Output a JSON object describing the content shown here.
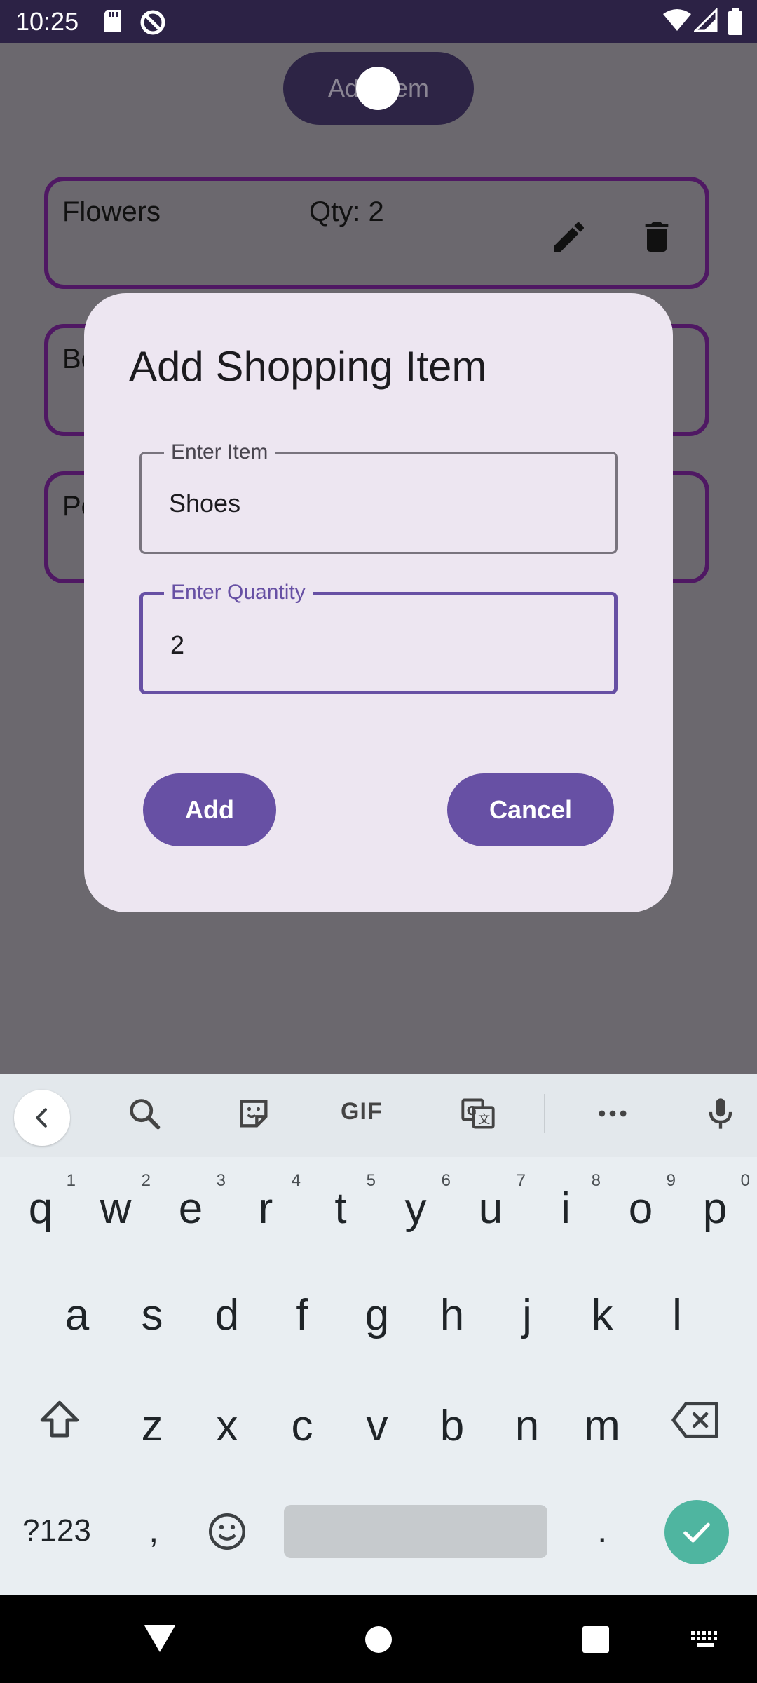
{
  "status_bar": {
    "time": "10:25"
  },
  "app": {
    "add_item_label": "Add Item",
    "items": [
      {
        "name": "Flowers",
        "qty": "Qty: 2"
      },
      {
        "name": "Bo",
        "qty": ""
      },
      {
        "name": "Pe",
        "qty": ""
      }
    ]
  },
  "dialog": {
    "title": "Add Shopping Item",
    "item_field": {
      "label": "Enter Item",
      "value": "Shoes"
    },
    "quantity_field": {
      "label": "Enter Quantity",
      "value": "2"
    },
    "add_label": "Add",
    "cancel_label": "Cancel"
  },
  "keyboard": {
    "toolbar": {
      "gif_label": "GIF"
    },
    "row1": [
      {
        "char": "q",
        "num": "1"
      },
      {
        "char": "w",
        "num": "2"
      },
      {
        "char": "e",
        "num": "3"
      },
      {
        "char": "r",
        "num": "4"
      },
      {
        "char": "t",
        "num": "5"
      },
      {
        "char": "y",
        "num": "6"
      },
      {
        "char": "u",
        "num": "7"
      },
      {
        "char": "i",
        "num": "8"
      },
      {
        "char": "o",
        "num": "9"
      },
      {
        "char": "p",
        "num": "0"
      }
    ],
    "row2": [
      "a",
      "s",
      "d",
      "f",
      "g",
      "h",
      "j",
      "k",
      "l"
    ],
    "row3": [
      "z",
      "x",
      "c",
      "v",
      "b",
      "n",
      "m"
    ],
    "symbols_label": "?123",
    "comma_label": ",",
    "period_label": "."
  },
  "colors": {
    "accent": "#6750a4",
    "item_border": "#4f1863",
    "enter_key": "#4fb5a0"
  }
}
